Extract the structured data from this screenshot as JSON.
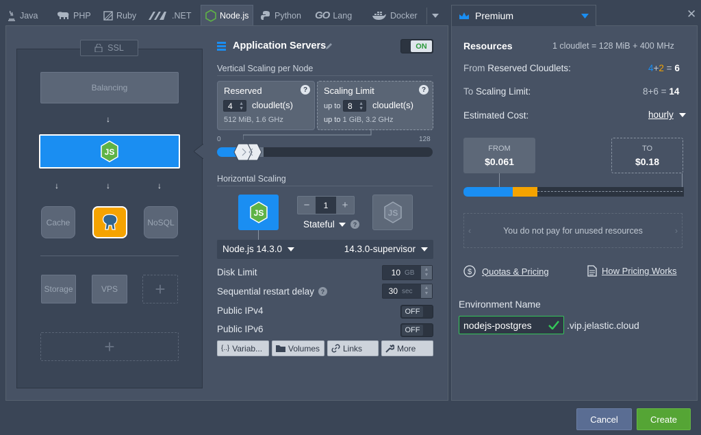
{
  "tabs": [
    {
      "label": "Java",
      "icon": "java-icon"
    },
    {
      "label": "PHP",
      "icon": "php-icon"
    },
    {
      "label": "Ruby",
      "icon": "ruby-icon"
    },
    {
      "label": ".NET",
      "icon": "dotnet-icon"
    },
    {
      "label": "Node.js",
      "icon": "nodejs-icon",
      "active": true
    },
    {
      "label": "Python",
      "icon": "python-icon"
    },
    {
      "label": "Lang",
      "icon": "go-icon",
      "prefix": "GO"
    },
    {
      "label": "Docker",
      "icon": "docker-icon"
    }
  ],
  "topology": {
    "ssl_label": "SSL",
    "balancing_label": "Balancing",
    "cache_label": "Cache",
    "nosql_label": "NoSQL",
    "storage_label": "Storage",
    "vps_label": "VPS"
  },
  "servers": {
    "title": "Application Servers",
    "toggle": "ON",
    "vertical_title": "Vertical Scaling per Node",
    "reserved": {
      "title": "Reserved",
      "value": "4",
      "unit": "cloudlet(s)",
      "info": "512 MiB, 1.6 GHz"
    },
    "limit": {
      "title": "Scaling Limit",
      "prefix": "up to",
      "value": "8",
      "unit": "cloudlet(s)",
      "info_prefix": "up to",
      "info": "1 GiB, 3.2 GHz"
    },
    "slider_min": "0",
    "slider_max": "128",
    "horizontal_title": "Horizontal Scaling",
    "node_count": "1",
    "stateful_label": "Stateful",
    "engine": "Node.js 14.3.0",
    "tag": "14.3.0-supervisor",
    "disk_label": "Disk Limit",
    "disk_value": "10",
    "disk_unit": "GB",
    "restart_label": "Sequential restart delay",
    "restart_value": "30",
    "restart_unit": "sec",
    "ipv4_label": "Public IPv4",
    "ipv4_value": "OFF",
    "ipv6_label": "Public IPv6",
    "ipv6_value": "OFF",
    "buttons": {
      "variables": "Variab...",
      "volumes": "Volumes",
      "links": "Links",
      "more": "More"
    }
  },
  "pricing": {
    "plan": "Premium",
    "resources_label": "Resources",
    "cloudlet_info": "1 cloudlet = 128 MiB + 400 MHz",
    "reserved_prefix": "From",
    "reserved_label": "Reserved Cloudlets:",
    "reserved_a": "4",
    "reserved_b": "2",
    "reserved_total": "6",
    "limit_prefix": "To",
    "limit_label": "Scaling Limit:",
    "limit_a": "8",
    "limit_b": "6",
    "limit_total": "14",
    "cost_label": "Estimated Cost:",
    "cost_period": "hourly",
    "from_label": "FROM",
    "from_value": "$0.061",
    "to_label": "TO",
    "to_value": "$0.18",
    "unused_note": "You do not pay for unused resources",
    "quotas_link": "Quotas & Pricing",
    "how_link": "How Pricing Works",
    "env_label": "Environment Name",
    "env_name": "nodejs-postgres",
    "env_domain": ".vip.jelastic.cloud"
  },
  "footer": {
    "cancel": "Cancel",
    "create": "Create"
  },
  "colors": {
    "accent": "#1a8ef2",
    "create": "#55a535",
    "cancel": "#5a6d93",
    "orange": "#f5a300",
    "ok": "#34c759"
  }
}
